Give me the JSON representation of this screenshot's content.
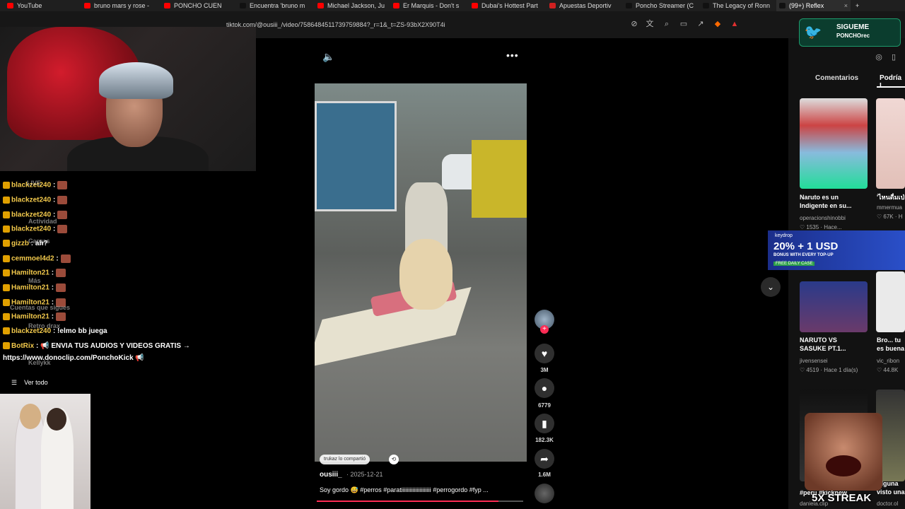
{
  "browser": {
    "tabs": [
      {
        "label": "YouTube",
        "color": "#ff0000"
      },
      {
        "label": "bruno mars y rose -",
        "color": "#ff0000"
      },
      {
        "label": "PONCHO CUEN",
        "color": "#ff0000"
      },
      {
        "label": "Encuentra 'bruno m",
        "color": "#111111"
      },
      {
        "label": "Michael Jackson, Ju",
        "color": "#ff0000"
      },
      {
        "label": "Er Marquis - Don't s",
        "color": "#ff0000"
      },
      {
        "label": "Dubai's Hottest Part",
        "color": "#ff0000"
      },
      {
        "label": "Apuestas Deportiv",
        "color": "#d02020"
      },
      {
        "label": "Poncho Streamer (C",
        "color": "#111111"
      },
      {
        "label": "The Legacy of Ronn",
        "color": "#111111"
      },
      {
        "label": "(99+) Reflex",
        "color": "#111111"
      }
    ],
    "url": "tiktok.com/@ousiii_/video/7586484511739759884?_r=1&_t=ZS-93bX2X90T4i"
  },
  "chat": {
    "messages": [
      {
        "user": "blackzet240",
        "text": ":"
      },
      {
        "user": "blackzet240",
        "text": ":"
      },
      {
        "user": "blackzet240",
        "text": ":"
      },
      {
        "user": "blackzet240",
        "text": ":"
      },
      {
        "user": "gizzb",
        "text": ": ah?"
      },
      {
        "user": "cemmoel4d2",
        "text": ":"
      },
      {
        "user": "Hamilton21",
        "text": ":"
      },
      {
        "user": "Hamilton21",
        "text": ":"
      },
      {
        "user": "Hamilton21",
        "text": ":"
      },
      {
        "user": "Hamilton21",
        "text": ":"
      },
      {
        "user": "blackzet240",
        "text": ": !elmo bb juega"
      },
      {
        "user": "BotRix",
        "text": ": 📢 ENVIA TUS AUDIOS Y VIDEOS GRATIS →"
      },
      {
        "user": "",
        "text": "https://www.donoclip.com/PonchoKick 📢"
      }
    ],
    "overlay_items": [
      "LIVE",
      "Actividad",
      "Cargas",
      "Más",
      "Cuentas que sigues",
      "Retro drax",
      "Kellykk"
    ],
    "ver_todo": "Ver todo"
  },
  "video": {
    "share_chip": "trukaz lo compartió",
    "author": "ousiii_",
    "date": "· 2025-12-21",
    "caption": "Soy gordo 😅 #perros #paratiiiiiiiiiiiiiiiiiiiii #perrogordo #fyp ...",
    "progress": 0.88,
    "likes": "3M",
    "comments": "6779",
    "saves": "182.3K",
    "shares": "1.6M"
  },
  "right_panel": {
    "tab_comments": "Comentarios",
    "tab_related": "Podría I",
    "cards": [
      {
        "title": "Naruto es un Indigente en su...",
        "channel": "operacionshinobbi",
        "meta": "♡ 1535 · Hace..."
      },
      {
        "title": "'ไหนดื่มเป่า",
        "channel": "mmermua",
        "meta": "♡ 67K · H"
      },
      {
        "title": "NARUTO VS SASUKE PT.1...",
        "channel": "jivensensei",
        "meta": "♡ 4519 · Hace 1 día(s)"
      },
      {
        "title": "Bro... tu es buena",
        "channel": "vic_ribon",
        "meta": "♡ 44.8K"
      },
      {
        "title": "#peru #kicknew",
        "channel": "daniela.clip",
        "meta": ""
      },
      {
        "title": "Alguna visto una",
        "channel": "doctor.ol",
        "meta": ""
      }
    ]
  },
  "overlays": {
    "twitter_line1": "SIGUEME",
    "twitter_line2": "PONCHOrec",
    "keydrop_brand": "keydrop",
    "keydrop_big": "20% + 1 USD",
    "keydrop_sub": "BONUS WITH EVERY TOP-UP",
    "keydrop_cta": "FREE DAILY CASE",
    "streak": "5X STREAK"
  },
  "colors": {
    "accent": "#fe2c55",
    "chat_user": "#f2c94c"
  }
}
